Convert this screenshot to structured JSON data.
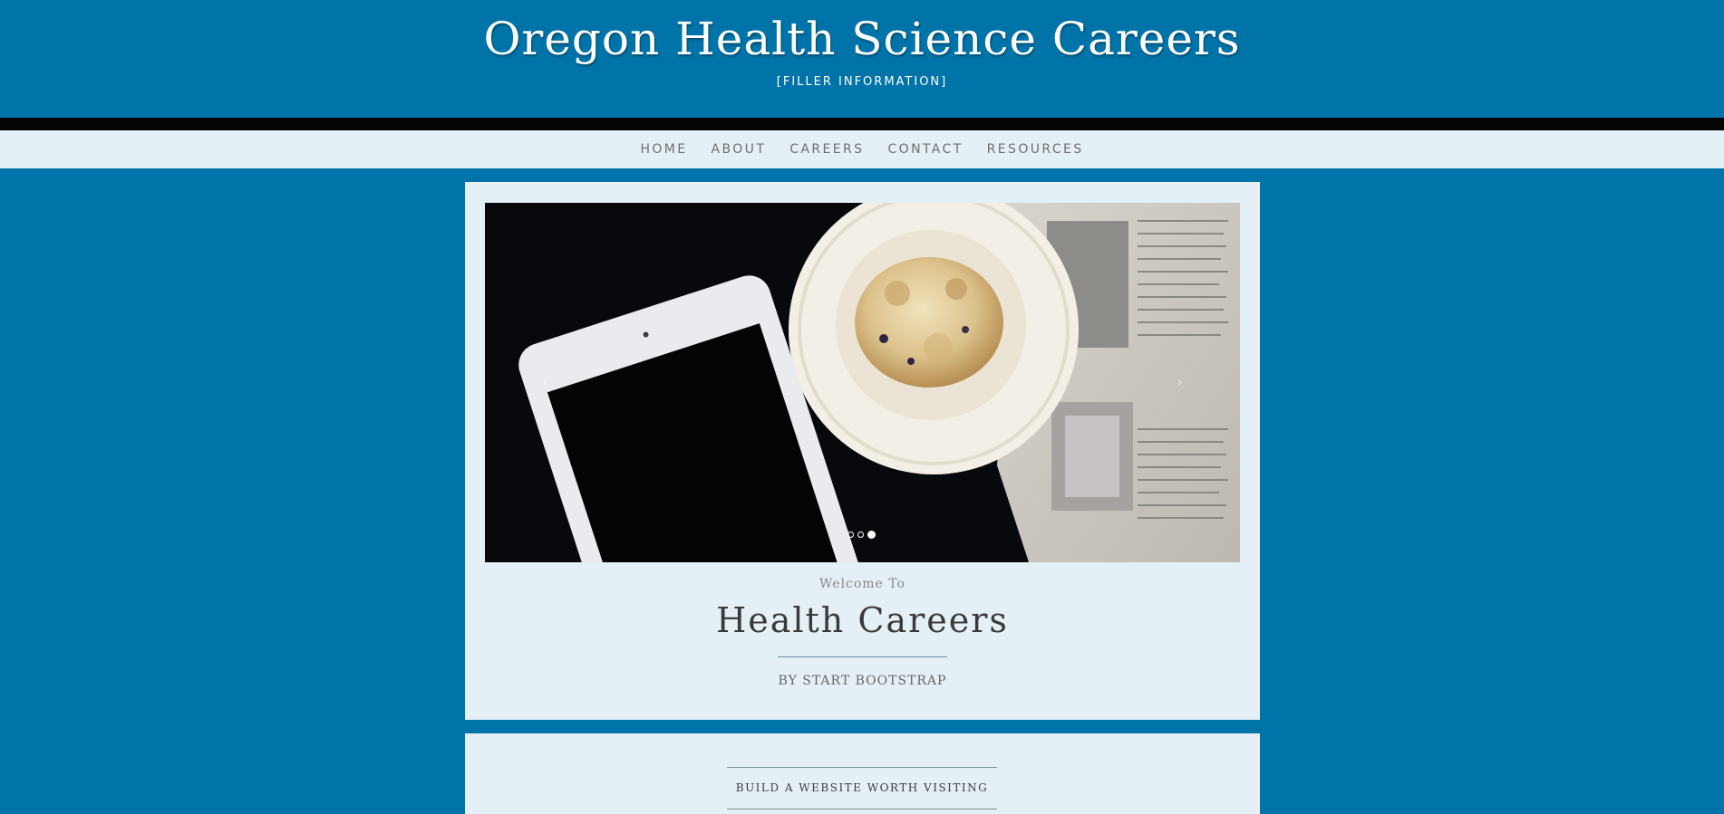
{
  "header": {
    "title": "Oregon Health Science Careers",
    "subtitle": "[FILLER INFORMATION]"
  },
  "nav": {
    "items": [
      "HOME",
      "ABOUT",
      "CAREERS",
      "CONTACT",
      "RESOURCES"
    ]
  },
  "carousel": {
    "prev_icon": "chevron-left-icon",
    "next_icon": "chevron-right-icon",
    "prev_glyph": "‹",
    "next_glyph": "›",
    "slide_count": 3,
    "active_slide": 3
  },
  "intro": {
    "welcome": "Welcome To",
    "title": "Health Careers",
    "byline": "BY START BOOTSTRAP"
  },
  "section2": {
    "heading": "BUILD A WEBSITE WORTH VISITING"
  },
  "colors": {
    "background": "#0074a8",
    "panel": "#e4f0f5",
    "band": "#050505"
  }
}
